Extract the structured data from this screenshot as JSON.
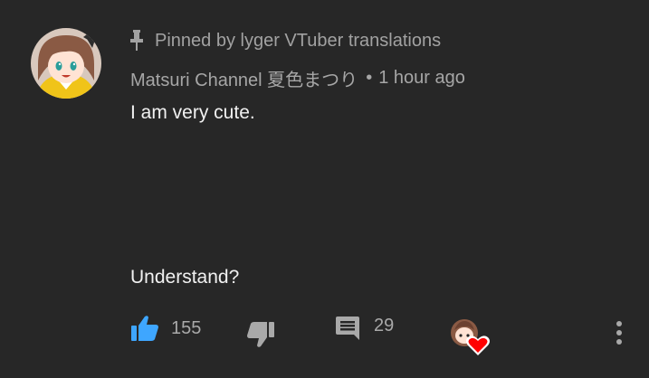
{
  "comment": {
    "pinned_text": "Pinned by lyger VTuber translations",
    "author": "Matsuri Channel 夏色まつり",
    "separator": "•",
    "timestamp": "1 hour ago",
    "body_line1": "I am very cute.",
    "body_line2": "Understand?",
    "like_count": "155",
    "reply_count": "29"
  },
  "colors": {
    "background": "#272727",
    "like_active": "#3ea6ff",
    "heart": "#ff0000",
    "meta_text": "#a6a6a6"
  },
  "icons": {
    "pin": "pin-icon",
    "like": "thumbs-up-icon",
    "dislike": "thumbs-down-icon",
    "reply": "comment-icon",
    "hearted": "creator-heart-icon",
    "more": "more-vertical-icon"
  }
}
